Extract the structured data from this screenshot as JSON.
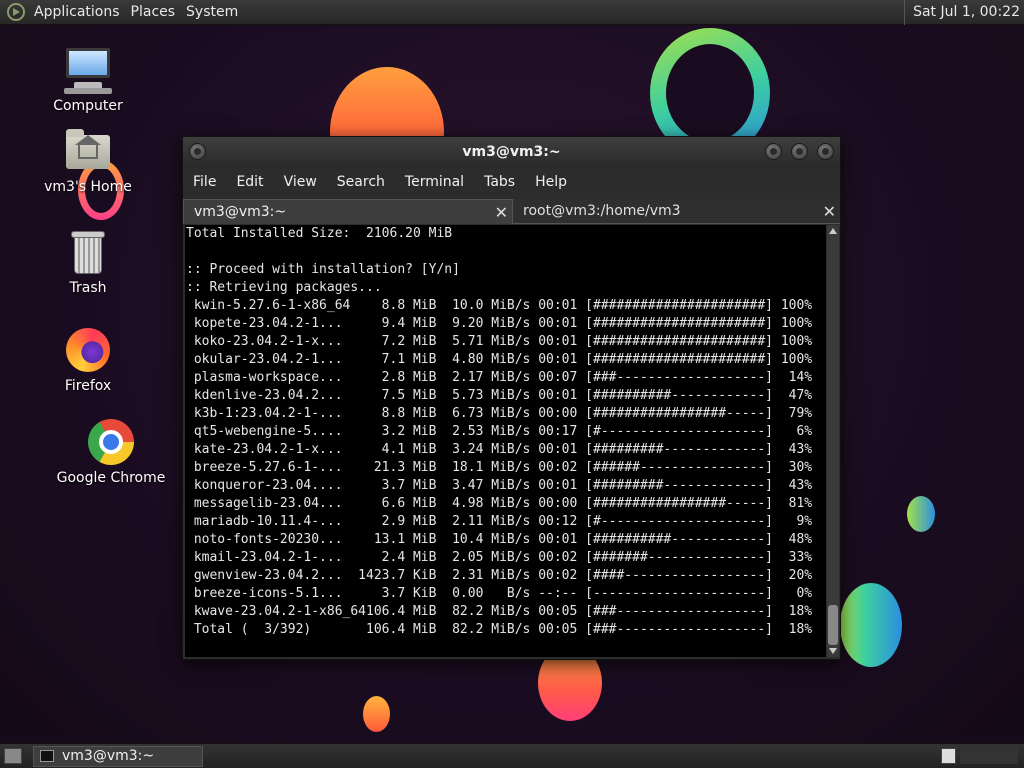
{
  "top_panel": {
    "menus": [
      "Applications",
      "Places",
      "System"
    ],
    "clock": "Sat Jul  1, 00:22"
  },
  "desktop_icons": [
    {
      "label": "Computer",
      "icon": "computer-icon"
    },
    {
      "label": "vm3's Home",
      "icon": "home-folder-icon"
    },
    {
      "label": "Trash",
      "icon": "trash-icon"
    },
    {
      "label": "Firefox",
      "icon": "firefox-icon"
    },
    {
      "label": "Google Chrome",
      "icon": "chrome-icon"
    }
  ],
  "window": {
    "title": "vm3@vm3:~",
    "menu": [
      "File",
      "Edit",
      "View",
      "Search",
      "Terminal",
      "Tabs",
      "Help"
    ],
    "tabs": [
      {
        "label": "vm3@vm3:~",
        "active": true
      },
      {
        "label": "root@vm3:/home/vm3",
        "active": false
      }
    ],
    "terminal_lines": [
      "Total Installed Size:  2106.20 MiB",
      "",
      ":: Proceed with installation? [Y/n]",
      ":: Retrieving packages...",
      " kwin-5.27.6-1-x86_64    8.8 MiB  10.0 MiB/s 00:01 [######################] 100%",
      " kopete-23.04.2-1...     9.4 MiB  9.20 MiB/s 00:01 [######################] 100%",
      " koko-23.04.2-1-x...     7.2 MiB  5.71 MiB/s 00:01 [######################] 100%",
      " okular-23.04.2-1...     7.1 MiB  4.80 MiB/s 00:01 [######################] 100%",
      " plasma-workspace...     2.8 MiB  2.17 MiB/s 00:07 [###-------------------]  14%",
      " kdenlive-23.04.2...     7.5 MiB  5.73 MiB/s 00:01 [##########------------]  47%",
      " k3b-1:23.04.2-1-...     8.8 MiB  6.73 MiB/s 00:00 [#################-----]  79%",
      " qt5-webengine-5....     3.2 MiB  2.53 MiB/s 00:17 [#---------------------]   6%",
      " kate-23.04.2-1-x...     4.1 MiB  3.24 MiB/s 00:01 [#########-------------]  43%",
      " breeze-5.27.6-1-...    21.3 MiB  18.1 MiB/s 00:02 [######----------------]  30%",
      " konqueror-23.04....     3.7 MiB  3.47 MiB/s 00:01 [#########-------------]  43%",
      " messagelib-23.04...     6.6 MiB  4.98 MiB/s 00:00 [#################-----]  81%",
      " mariadb-10.11.4-...     2.9 MiB  2.11 MiB/s 00:12 [#---------------------]   9%",
      " noto-fonts-20230...    13.1 MiB  10.4 MiB/s 00:01 [##########------------]  48%",
      " kmail-23.04.2-1-...     2.4 MiB  2.05 MiB/s 00:02 [#######---------------]  33%",
      " gwenview-23.04.2...  1423.7 KiB  2.31 MiB/s 00:02 [####------------------]  20%",
      " breeze-icons-5.1...     3.7 KiB  0.00   B/s --:-- [----------------------]   0%",
      " kwave-23.04.2-1-x86_64106.4 MiB  82.2 MiB/s 00:05 [###-------------------]  18%",
      " Total (  3/392)       106.4 MiB  82.2 MiB/s 00:05 [###-------------------]  18%"
    ]
  },
  "bottom_panel": {
    "task_label": "vm3@vm3:~"
  }
}
